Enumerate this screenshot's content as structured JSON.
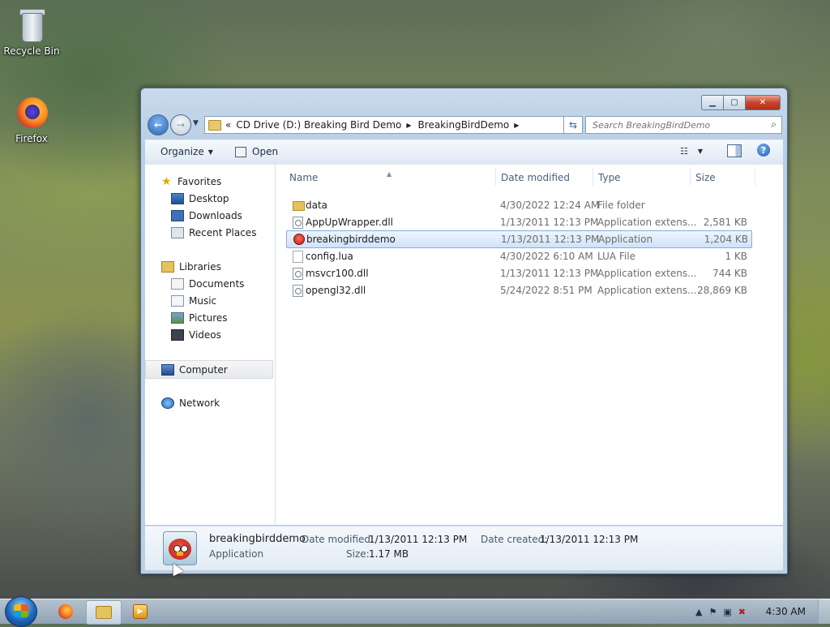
{
  "desktop": {
    "icons": [
      {
        "label": "Recycle Bin",
        "icon": "recycle-bin-icon"
      },
      {
        "label": "Firefox",
        "icon": "firefox-icon"
      }
    ]
  },
  "window": {
    "address": {
      "overflow": "«",
      "crumbs": [
        "CD Drive (D:) Breaking Bird Demo",
        "BreakingBirdDemo"
      ]
    },
    "search_placeholder": "Search BreakingBirdDemo",
    "toolbar": {
      "organize_label": "Organize",
      "open_label": "Open"
    },
    "nav_pane": {
      "favorites": {
        "label": "Favorites",
        "items": [
          "Desktop",
          "Downloads",
          "Recent Places"
        ]
      },
      "libraries": {
        "label": "Libraries",
        "items": [
          "Documents",
          "Music",
          "Pictures",
          "Videos"
        ]
      },
      "computer": "Computer",
      "network": "Network"
    },
    "columns": {
      "name": "Name",
      "date": "Date modified",
      "type": "Type",
      "size": "Size"
    },
    "files": [
      {
        "name": "data",
        "date": "4/30/2022 12:24 AM",
        "type": "File folder",
        "size": "",
        "icon": "folder-icon"
      },
      {
        "name": "AppUpWrapper.dll",
        "date": "1/13/2011 12:13 PM",
        "type": "Application extens...",
        "size": "2,581 KB",
        "icon": "dll-file-icon"
      },
      {
        "name": "breakingbirddemo",
        "date": "1/13/2011 12:13 PM",
        "type": "Application",
        "size": "1,204 KB",
        "icon": "app-icon",
        "selected": true
      },
      {
        "name": "config.lua",
        "date": "4/30/2022 6:10 AM",
        "type": "LUA File",
        "size": "1 KB",
        "icon": "lua-file-icon"
      },
      {
        "name": "msvcr100.dll",
        "date": "1/13/2011 12:13 PM",
        "type": "Application extens...",
        "size": "744 KB",
        "icon": "dll-file-icon"
      },
      {
        "name": "opengl32.dll",
        "date": "5/24/2022 8:51 PM",
        "type": "Application extens...",
        "size": "28,869 KB",
        "icon": "dll-file-icon"
      }
    ],
    "details": {
      "name": "breakingbirddemo",
      "type": "Application",
      "modified_label": "Date modified:",
      "modified_value": "1/13/2011 12:13 PM",
      "created_label": "Date created:",
      "created_value": "1/13/2011 12:13 PM",
      "size_label": "Size:",
      "size_value": "1.17 MB"
    }
  },
  "taskbar": {
    "clock": "4:30 AM",
    "apps": [
      "firefox-icon",
      "explorer-icon",
      "media-player-icon"
    ]
  }
}
